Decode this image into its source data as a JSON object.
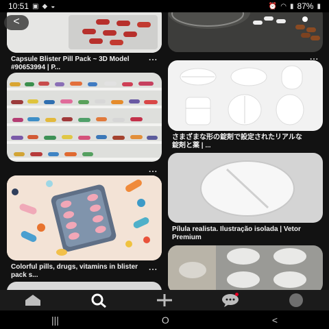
{
  "status": {
    "time": "10:51",
    "battery": "87%"
  },
  "pins_left": [
    {
      "title": "Capsule Blister Pill Pack ~ 3D Model #90653994 | P...",
      "image_icon": "capsule-blister-pack"
    },
    {
      "title": "",
      "image_icon": "pill-shelves"
    },
    {
      "title": "Colorful pills, drugs, vitamins in blister pack s...",
      "image_icon": "illustrated-pills"
    },
    {
      "title": "",
      "image_icon": "blister-pack"
    }
  ],
  "pins_right": [
    {
      "title": "",
      "image_icon": "capsules-glass"
    },
    {
      "title": "さまざまな形の錠剤で設定されたリアルな錠剤と薬 | ...",
      "image_icon": "white-tablets"
    },
    {
      "title": "Pílula realista. Ilustração isolada | Vetor Premium",
      "image_icon": "white-pill"
    },
    {
      "title": "",
      "image_icon": "pill-blister-silver"
    }
  ],
  "more_label": "...",
  "back_label": "<",
  "nav": {
    "home": "home-icon",
    "search": "search-icon",
    "create": "plus-icon",
    "messages": "chat-icon",
    "profile": "avatar-icon"
  },
  "system_nav": {
    "recent": "|||",
    "home": "O",
    "back": "<"
  }
}
